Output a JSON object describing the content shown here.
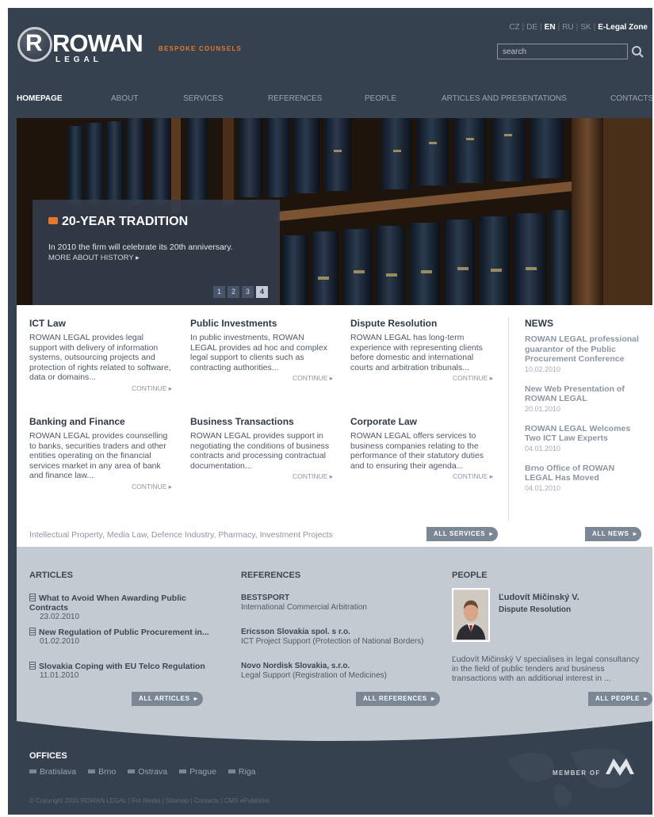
{
  "brand": {
    "logo_r": "R",
    "logo_word": "ROWAN",
    "logo_sub": "LEGAL",
    "tagline": "BESPOKE COUNSELS"
  },
  "header": {
    "languages": [
      "CZ",
      "DE",
      "EN",
      "RU",
      "SK"
    ],
    "active_language": "EN",
    "e_legal_zone": "E-Legal Zone",
    "search_placeholder": "search"
  },
  "nav": [
    {
      "label": "HOMEPAGE",
      "active": true
    },
    {
      "label": "ABOUT"
    },
    {
      "label": "SERVICES"
    },
    {
      "label": "REFERENCES"
    },
    {
      "label": "PEOPLE"
    },
    {
      "label": "ARTICLES AND PRESENTATIONS"
    },
    {
      "label": "CONTACTS"
    }
  ],
  "hero": {
    "title": "20-YEAR TRADITION",
    "text": "In 2010 the firm will celebrate its 20th anniversary.",
    "more": "MORE ABOUT HISTORY ▸",
    "pages": [
      "1",
      "2",
      "3",
      "4"
    ],
    "active_page": "4"
  },
  "services": [
    {
      "title": "ICT Law",
      "text": "ROWAN LEGAL provides legal support with delivery of information systems, outsourcing projects and protection of rights related to software, data or domains...",
      "more": "CONTINUE ▸"
    },
    {
      "title": "Public Investments",
      "text": "In public investments, ROWAN LEGAL provides ad hoc and complex legal support to clients such as contracting authorities...",
      "more": "CONTINUE ▸"
    },
    {
      "title": "Dispute Resolution",
      "text": "ROWAN LEGAL has long-term experience with representing clients before domestic and international courts and arbitration tribunals...",
      "more": "CONTINUE ▸"
    },
    {
      "title": "Banking and Finance",
      "text": "ROWAN LEGAL provides counselling to banks, securities traders and other entities operating on the financial services market in any area of bank and finance law...",
      "more": "CONTINUE ▸"
    },
    {
      "title": "Business Transactions",
      "text": "ROWAN LEGAL provides support in negotiating the conditions of business contracts and processing contractual documentation...",
      "more": "CONTINUE ▸"
    },
    {
      "title": "Corporate Law",
      "text": "ROWAN LEGAL offers services to business companies relating to the performance of their statutory duties and to ensuring their agenda...",
      "more": "CONTINUE ▸"
    }
  ],
  "service_tags": "Intellectual Property, Media Law, Defence Industry, Pharmacy, Investment Projects",
  "all_services": "ALL SERVICES",
  "news": {
    "heading": "NEWS",
    "items": [
      {
        "title": "ROWAN LEGAL professional guarantor of the Public Procurement Conference",
        "date": "10.02.2010"
      },
      {
        "title": "New Web Presentation of ROWAN LEGAL",
        "date": "20.01.2010"
      },
      {
        "title": "ROWAN LEGAL Welcomes Two ICT Law Experts",
        "date": "04.01.2010"
      },
      {
        "title": "Brno Office of ROWAN LEGAL Has Moved",
        "date": "04.01.2010"
      }
    ],
    "all": "ALL NEWS"
  },
  "articles": {
    "heading": "ARTICLES",
    "items": [
      {
        "title": "What to Avoid When Awarding Public Contracts",
        "date": "23.02.2010"
      },
      {
        "title": "New Regulation of Public Procurement in...",
        "date": "01.02.2010"
      },
      {
        "title": "Slovakia Coping with EU Telco Regulation",
        "date": "11.01.2010"
      }
    ],
    "all": "ALL ARTICLES"
  },
  "references": {
    "heading": "REFERENCES",
    "items": [
      {
        "title": "BESTSPORT",
        "desc": "International Commercial Arbitration"
      },
      {
        "title": "Ericsson Slovakia spol. s r.o.",
        "desc": "ICT Project Support (Protection of National Borders)"
      },
      {
        "title": "Novo Nordisk Slovakia, s.r.o.",
        "desc": "Legal Support (Registration of Medicines)"
      }
    ],
    "all": "ALL REFERENCES"
  },
  "people": {
    "heading": "PEOPLE",
    "name": "Ľudovít Mičinský V.",
    "role": "Dispute Resolution",
    "bio": "Ľudovít Mičinský V specialises in legal consultancy in the field of public tenders and business transactions with an additional interest in ...",
    "all": "ALL PEOPLE"
  },
  "footer": {
    "offices_heading": "OFFICES",
    "offices": [
      "Bratislava",
      "Brno",
      "Ostrava",
      "Prague",
      "Riga"
    ],
    "member_of": "MEMBER OF",
    "copyright": "© Copyright 2010 ROWAN LEGAL | For Media | Sitemap | Contacts | CMS ePublisher"
  },
  "colors": {
    "background": "#36414f",
    "accent": "#e7782b",
    "panel": "#c4cad1",
    "button": "#7b8795"
  }
}
